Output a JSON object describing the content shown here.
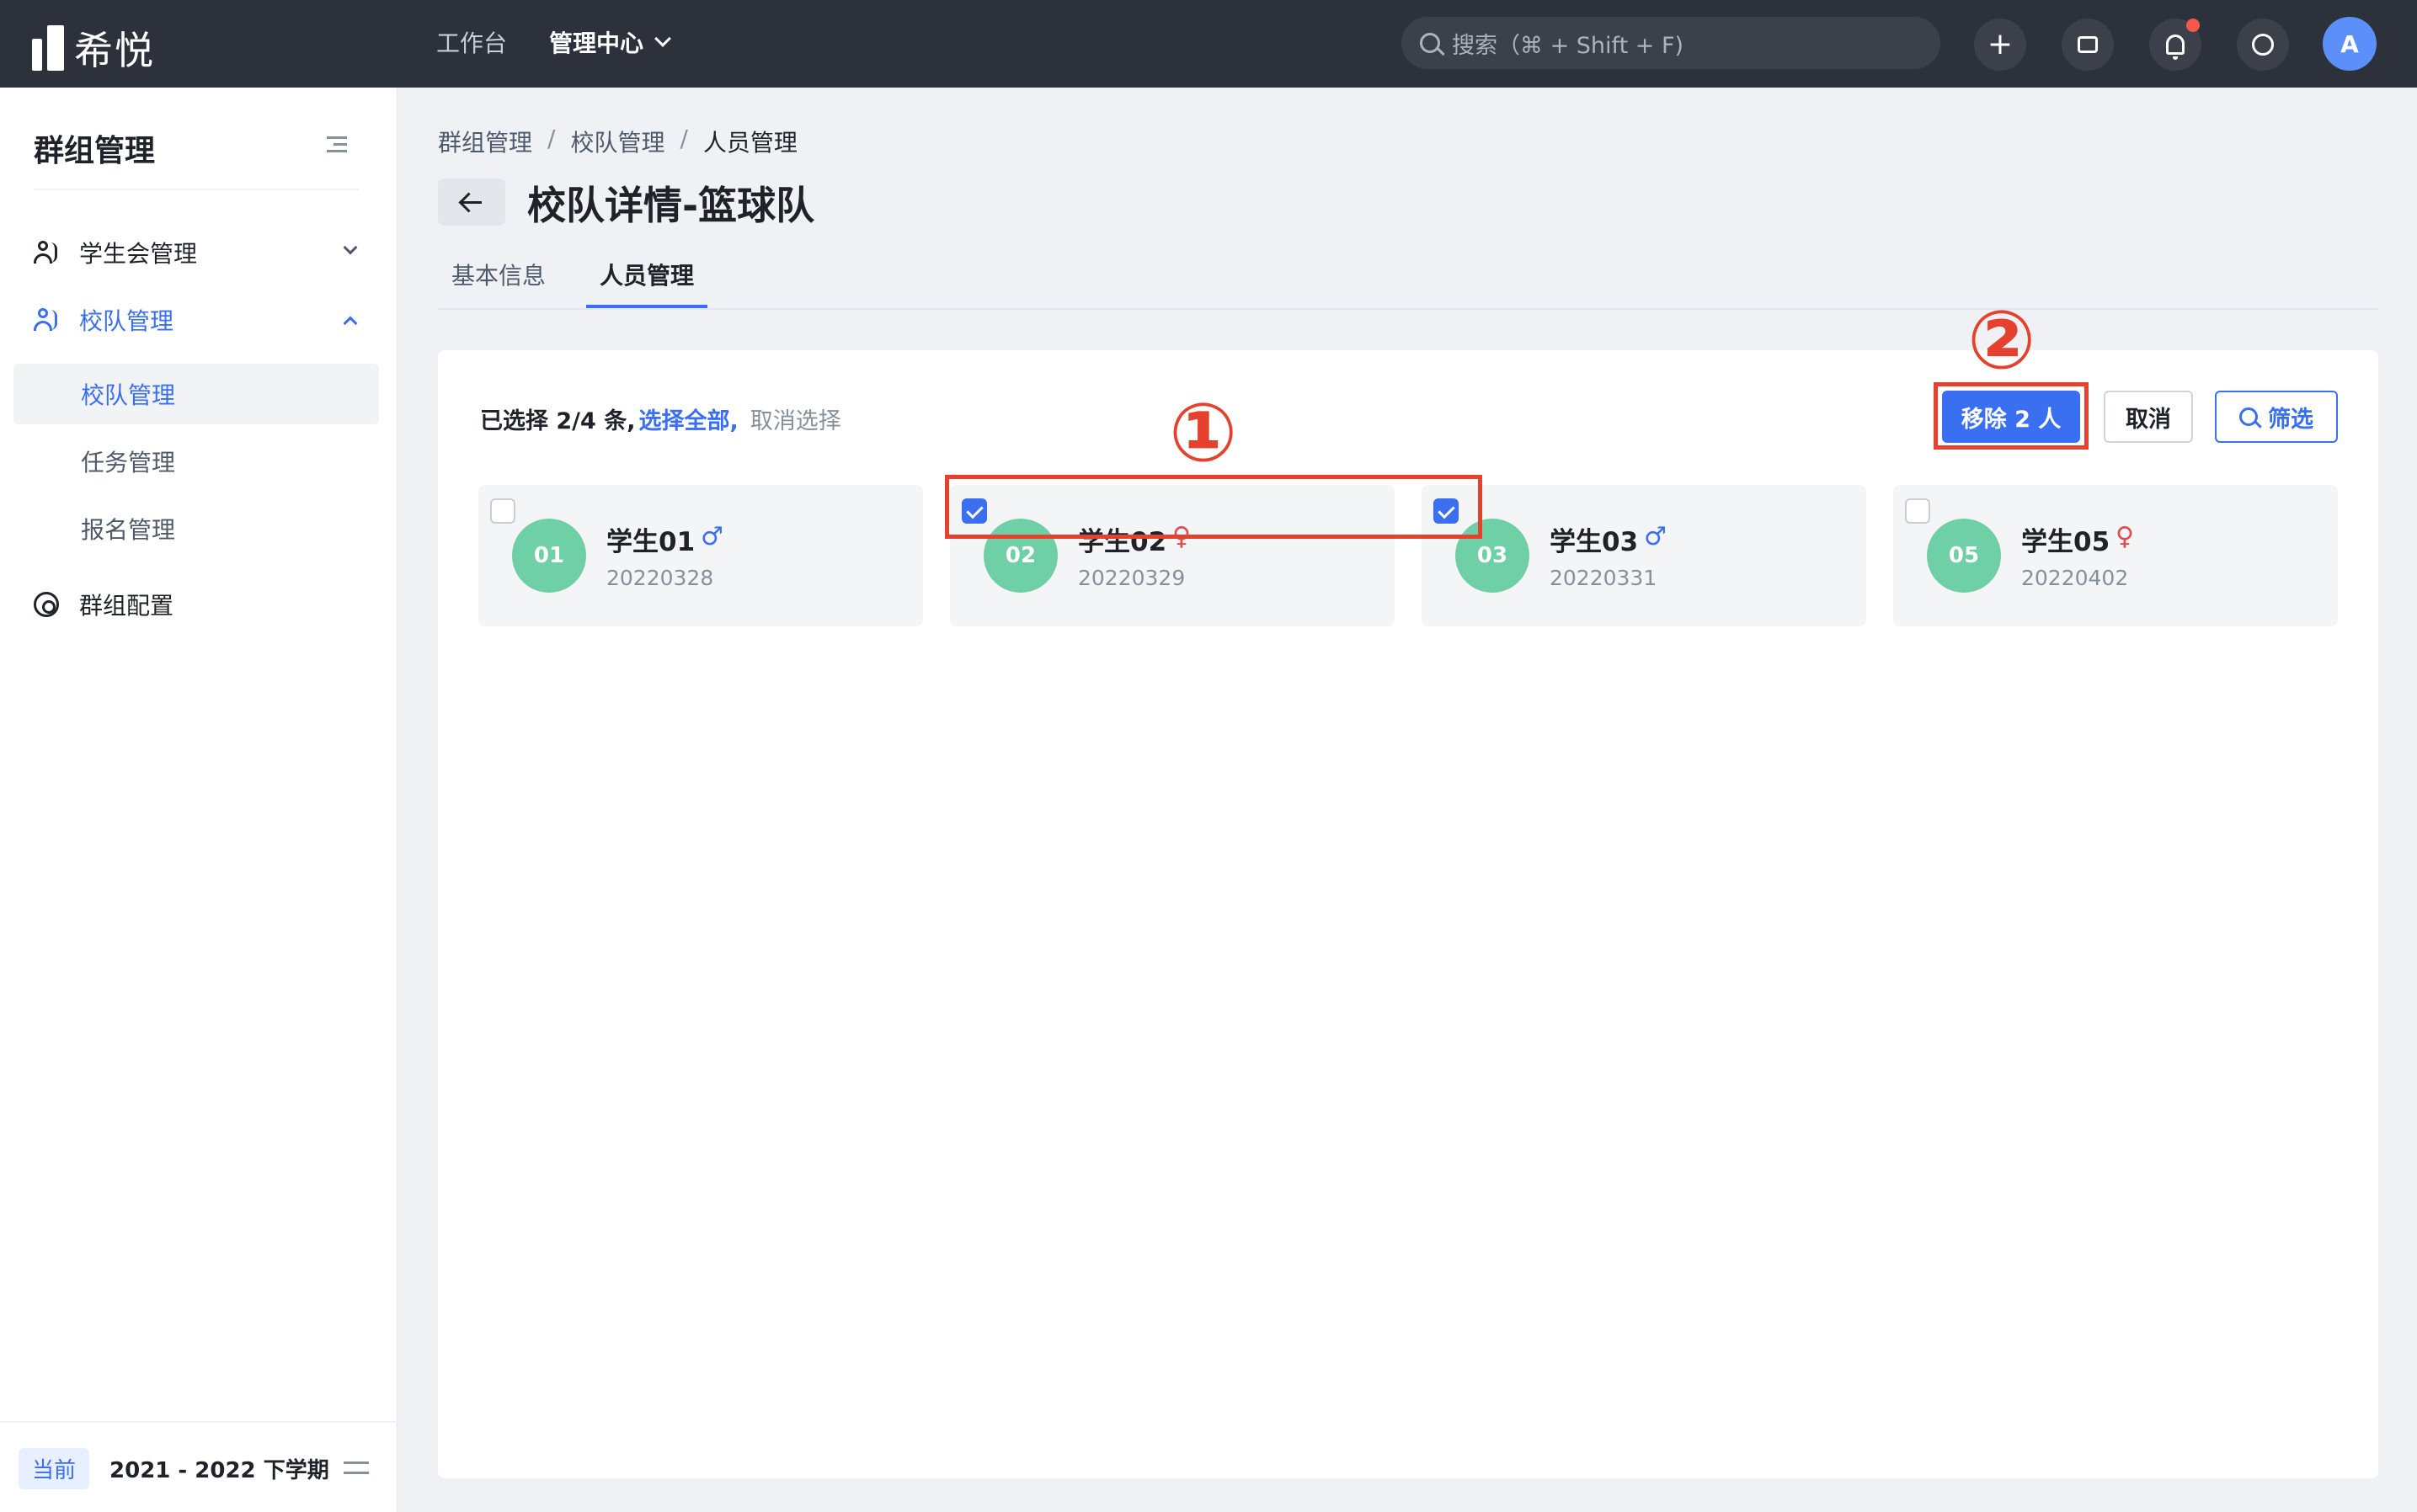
{
  "topbar": {
    "logo_text": "希悦",
    "nav": [
      {
        "label": "工作台"
      },
      {
        "label": "管理中心"
      }
    ],
    "search_placeholder": "搜索（⌘ + Shift + F)",
    "avatar_initial": "A"
  },
  "sidebar": {
    "title": "群组管理",
    "menu": [
      {
        "label": "学生会管理"
      },
      {
        "label": "校队管理"
      },
      {
        "label": "群组配置"
      }
    ],
    "submenu": [
      {
        "label": "校队管理"
      },
      {
        "label": "任务管理"
      },
      {
        "label": "报名管理"
      }
    ],
    "term_badge": "当前",
    "term_text": "2021 - 2022 下学期"
  },
  "breadcrumb": [
    "群组管理",
    "校队管理",
    "人员管理"
  ],
  "page_title": "校队详情-篮球队",
  "tabs": [
    {
      "label": "基本信息"
    },
    {
      "label": "人员管理"
    }
  ],
  "selection": {
    "count_text": "已选择 2/4 条,",
    "select_all": "选择全部,",
    "clear": "取消选择"
  },
  "buttons": {
    "remove": "移除 2 人",
    "cancel": "取消",
    "filter": "筛选"
  },
  "students": [
    {
      "num": "01",
      "name": "学生01",
      "gender": "♂",
      "id": "20220328",
      "checked": false
    },
    {
      "num": "02",
      "name": "学生02",
      "gender": "♀",
      "id": "20220329",
      "checked": true
    },
    {
      "num": "03",
      "name": "学生03",
      "gender": "♂",
      "id": "20220331",
      "checked": true
    },
    {
      "num": "05",
      "name": "学生05",
      "gender": "♀",
      "id": "20220402",
      "checked": false
    }
  ],
  "annotations": {
    "step1": "①",
    "step2": "②"
  },
  "colors": {
    "accent": "#3a6ff2",
    "annotation": "#e5412f",
    "avatar_green": "#6fcfa6"
  }
}
